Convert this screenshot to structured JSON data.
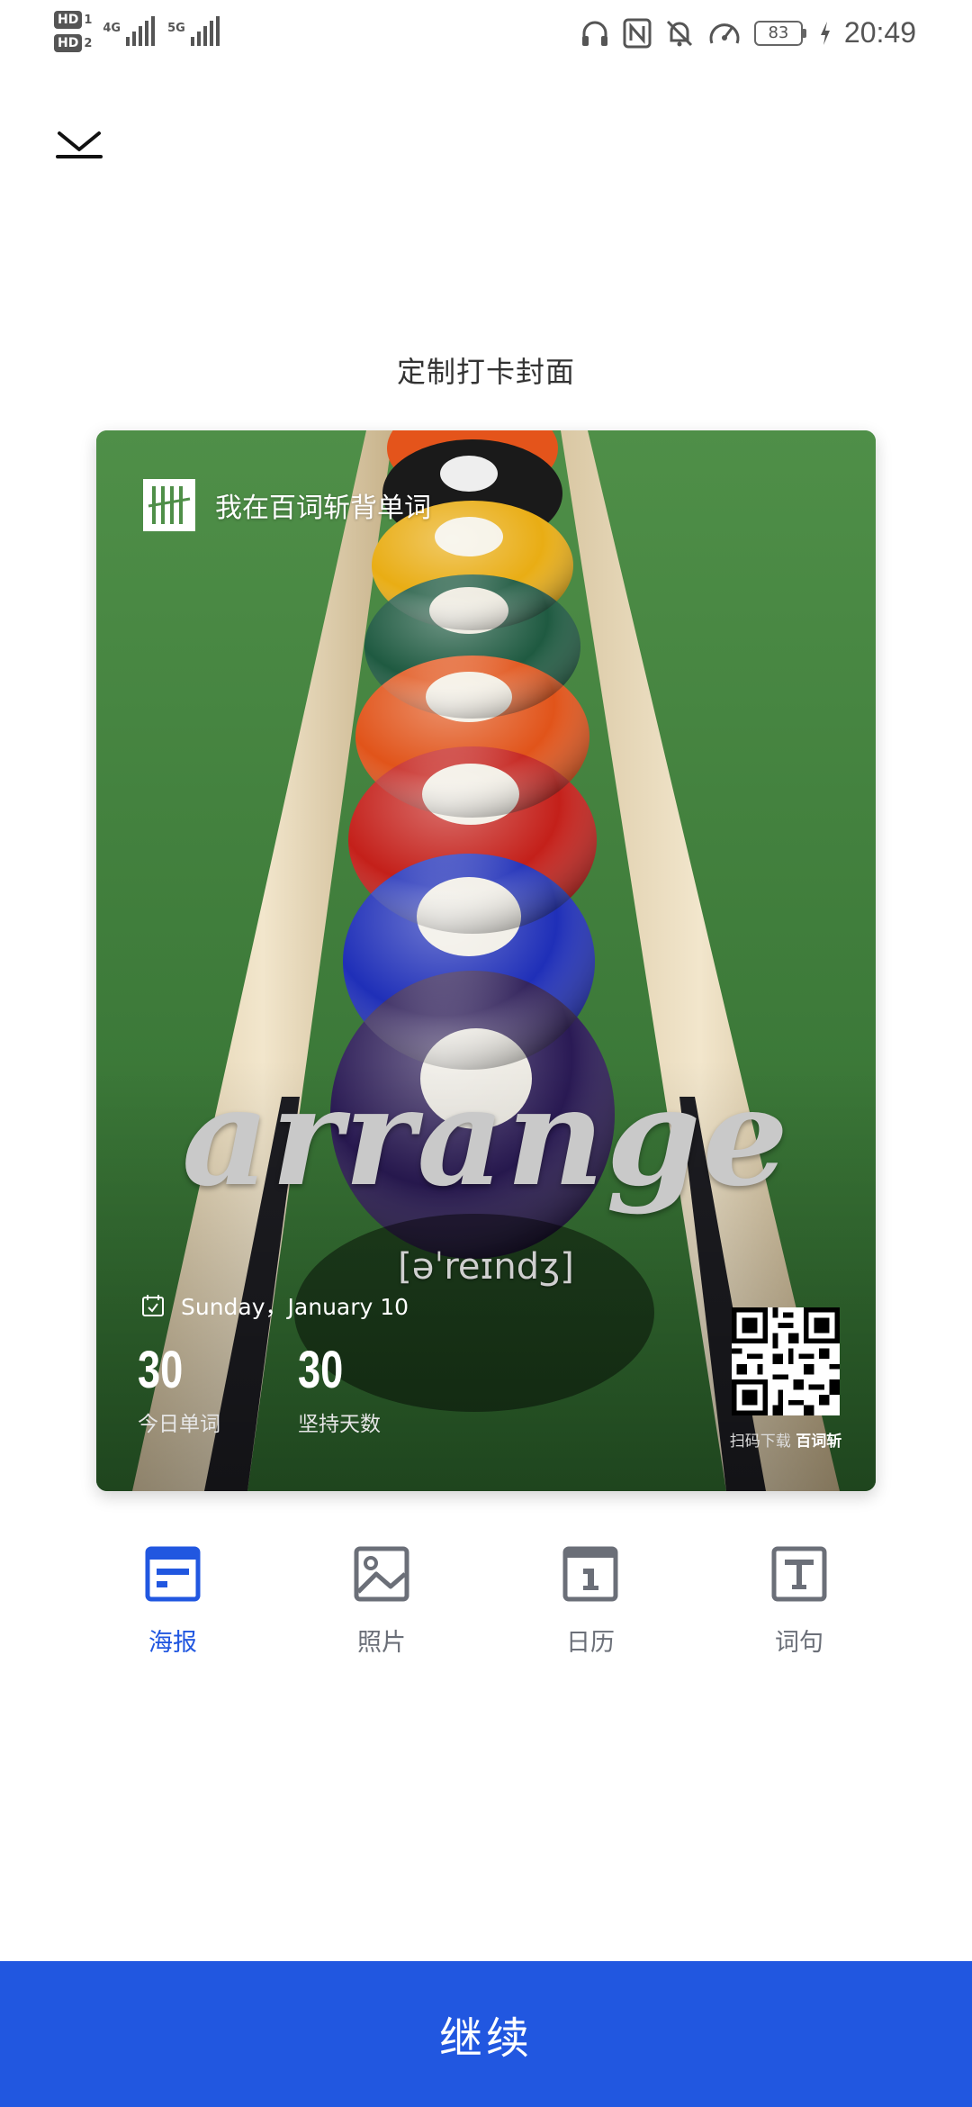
{
  "status_bar": {
    "hd1": "HD",
    "hd1_sub": "1",
    "hd2": "HD",
    "hd2_sub": "2",
    "net1": "4G",
    "net2": "5G",
    "battery": "83",
    "time": "20:49",
    "icons": [
      "headphones-icon",
      "nfc-icon",
      "silent-bell-icon",
      "speed-icon",
      "battery-icon",
      "charging-icon"
    ]
  },
  "page": {
    "title": "定制打卡封面"
  },
  "poster": {
    "brand_text": "我在百词斩背单词",
    "word": "arrange",
    "phonetic": "[əˈreɪndʒ]",
    "date": "Sunday，January 10",
    "today_words_count": "30",
    "today_words_label": "今日单词",
    "streak_days_count": "30",
    "streak_days_label": "坚持天数",
    "qr_caption_prefix": "扫码下载",
    "qr_caption_brand": "百词斩"
  },
  "tabs": [
    {
      "label": "海报",
      "icon": "poster-icon",
      "active": true
    },
    {
      "label": "照片",
      "icon": "photo-icon",
      "active": false
    },
    {
      "label": "日历",
      "icon": "calendar-icon",
      "active": false
    },
    {
      "label": "词句",
      "icon": "text-icon",
      "active": false
    }
  ],
  "colors": {
    "accent": "#2157e0",
    "tab_inactive": "#6b6f78",
    "felt_green": "#3f7f3d"
  },
  "continue_label": "继续"
}
